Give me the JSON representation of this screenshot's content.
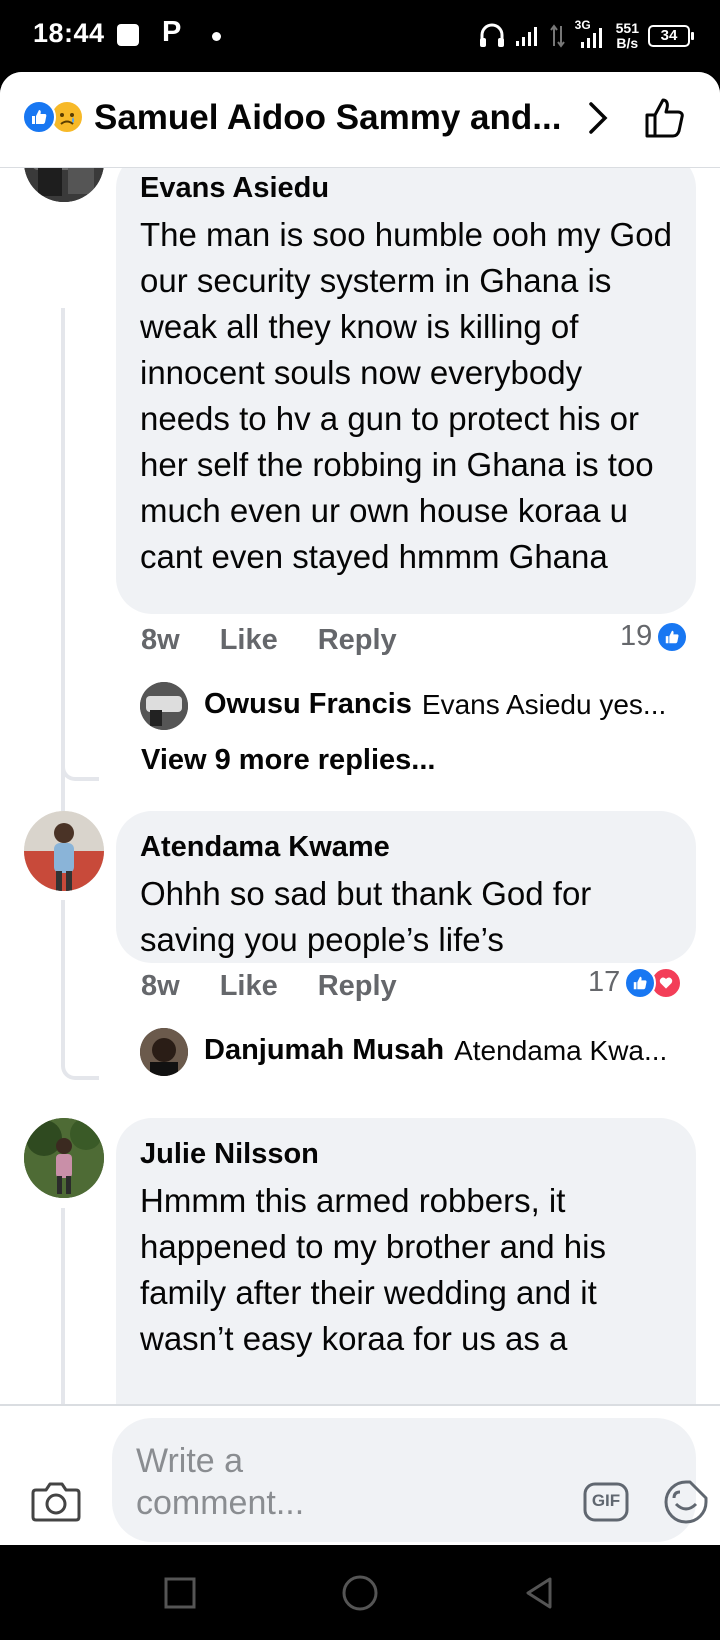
{
  "status_bar": {
    "time": "18:44",
    "notif_letter": "P",
    "network_type": "3G",
    "speed_value": "551",
    "speed_unit": "B/s",
    "battery": "34"
  },
  "header": {
    "title": "Samuel Aidoo Sammy and...",
    "reaction_icons": [
      "like-icon",
      "sad-icon"
    ]
  },
  "comments": [
    {
      "author": "Evans Asiedu",
      "text": "The man is soo humble ooh my God our security systerm in Ghana is weak all they know is killing of innocent souls now everybody needs to hv a gun to protect his or her self the robbing in Ghana is too much even ur own house koraa u cant even stayed hmmm Ghana",
      "time": "8w",
      "like_label": "Like",
      "reply_label": "Reply",
      "reaction_count": "19",
      "reaction_icons": [
        "like-icon"
      ],
      "reply_preview": {
        "author": "Owusu Francis",
        "text": "Evans Asiedu yes..."
      },
      "view_more": "View 9 more replies..."
    },
    {
      "author": "Atendama Kwame",
      "text": "Ohhh so sad but thank God for saving you people’s life’s",
      "time": "8w",
      "like_label": "Like",
      "reply_label": "Reply",
      "reaction_count": "17",
      "reaction_icons": [
        "like-icon",
        "love-icon"
      ],
      "reply_preview": {
        "author": "Danjumah Musah",
        "text": "Atendama Kwa..."
      }
    },
    {
      "author": "Julie Nilsson",
      "text": "Hmmm this armed robbers, it happened to my brother and his family after their wedding and it wasn’t easy koraa for us as a"
    }
  ],
  "composer": {
    "placeholder": "Write a comment...",
    "gif_label": "GIF"
  },
  "colors": {
    "accent": "#1877f2",
    "bubble": "#f0f2f5",
    "secondary_text": "#65676b",
    "love": "#f33e58",
    "sad": "#f7b928"
  }
}
